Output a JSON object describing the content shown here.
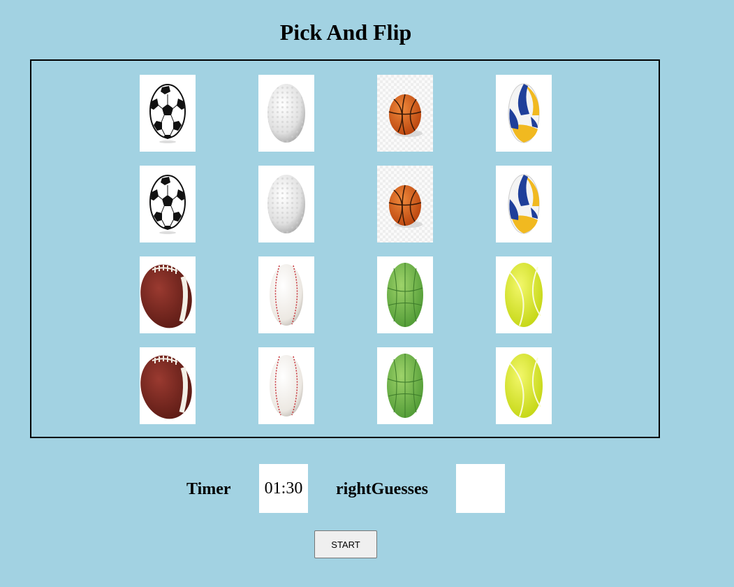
{
  "title": "Pick And Flip",
  "board": {
    "cards": [
      {
        "ball": "soccer-ball"
      },
      {
        "ball": "golf-ball"
      },
      {
        "ball": "basketball"
      },
      {
        "ball": "volleyball"
      },
      {
        "ball": "soccer-ball"
      },
      {
        "ball": "golf-ball"
      },
      {
        "ball": "basketball"
      },
      {
        "ball": "volleyball"
      },
      {
        "ball": "american-football"
      },
      {
        "ball": "baseball"
      },
      {
        "ball": "green-handball"
      },
      {
        "ball": "tennis-ball"
      },
      {
        "ball": "american-football"
      },
      {
        "ball": "baseball"
      },
      {
        "ball": "green-handball"
      },
      {
        "ball": "tennis-ball"
      }
    ]
  },
  "stats": {
    "timer_label": "Timer",
    "timer_value": "01:30",
    "right_guesses_label": "rightGuesses",
    "right_guesses_value": ""
  },
  "controls": {
    "start_label": "START"
  }
}
